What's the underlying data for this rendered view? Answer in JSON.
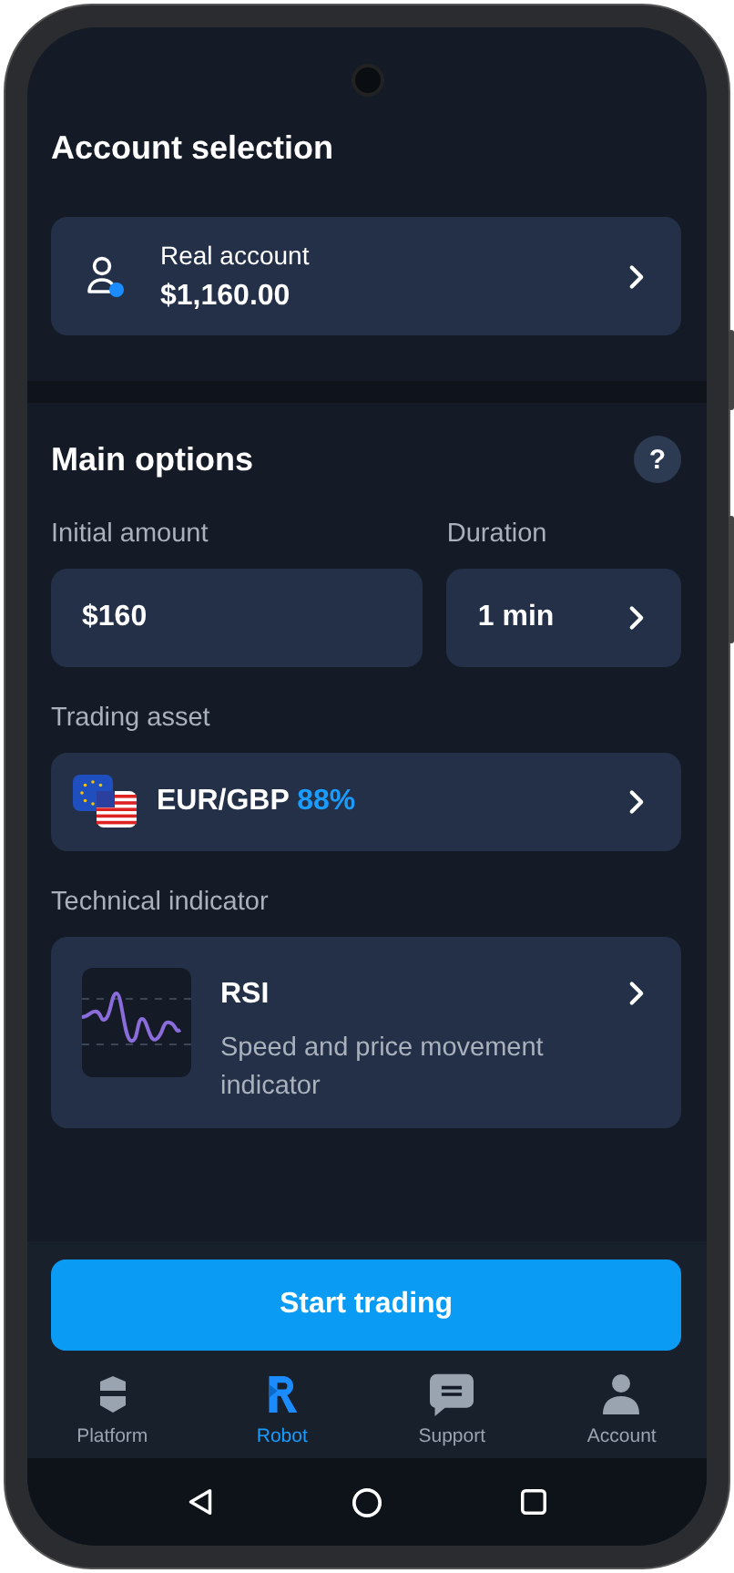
{
  "account_selection": {
    "title": "Account selection",
    "account": {
      "label": "Real account",
      "balance": "$1,160.00"
    }
  },
  "main_options": {
    "title": "Main options",
    "help": "?",
    "initial_amount": {
      "label": "Initial amount",
      "value": "$160"
    },
    "duration": {
      "label": "Duration",
      "value": "1 min"
    },
    "trading_asset": {
      "label": "Trading asset",
      "pair": "EUR/GBP",
      "payout": "88%"
    },
    "technical_indicator": {
      "label": "Technical indicator",
      "name": "RSI",
      "description": "Speed and price movement indicator"
    }
  },
  "start_button": "Start trading",
  "nav": [
    {
      "label": "Platform",
      "selected": false
    },
    {
      "label": "Robot",
      "selected": true
    },
    {
      "label": "Support",
      "selected": false
    },
    {
      "label": "Account",
      "selected": false
    }
  ]
}
